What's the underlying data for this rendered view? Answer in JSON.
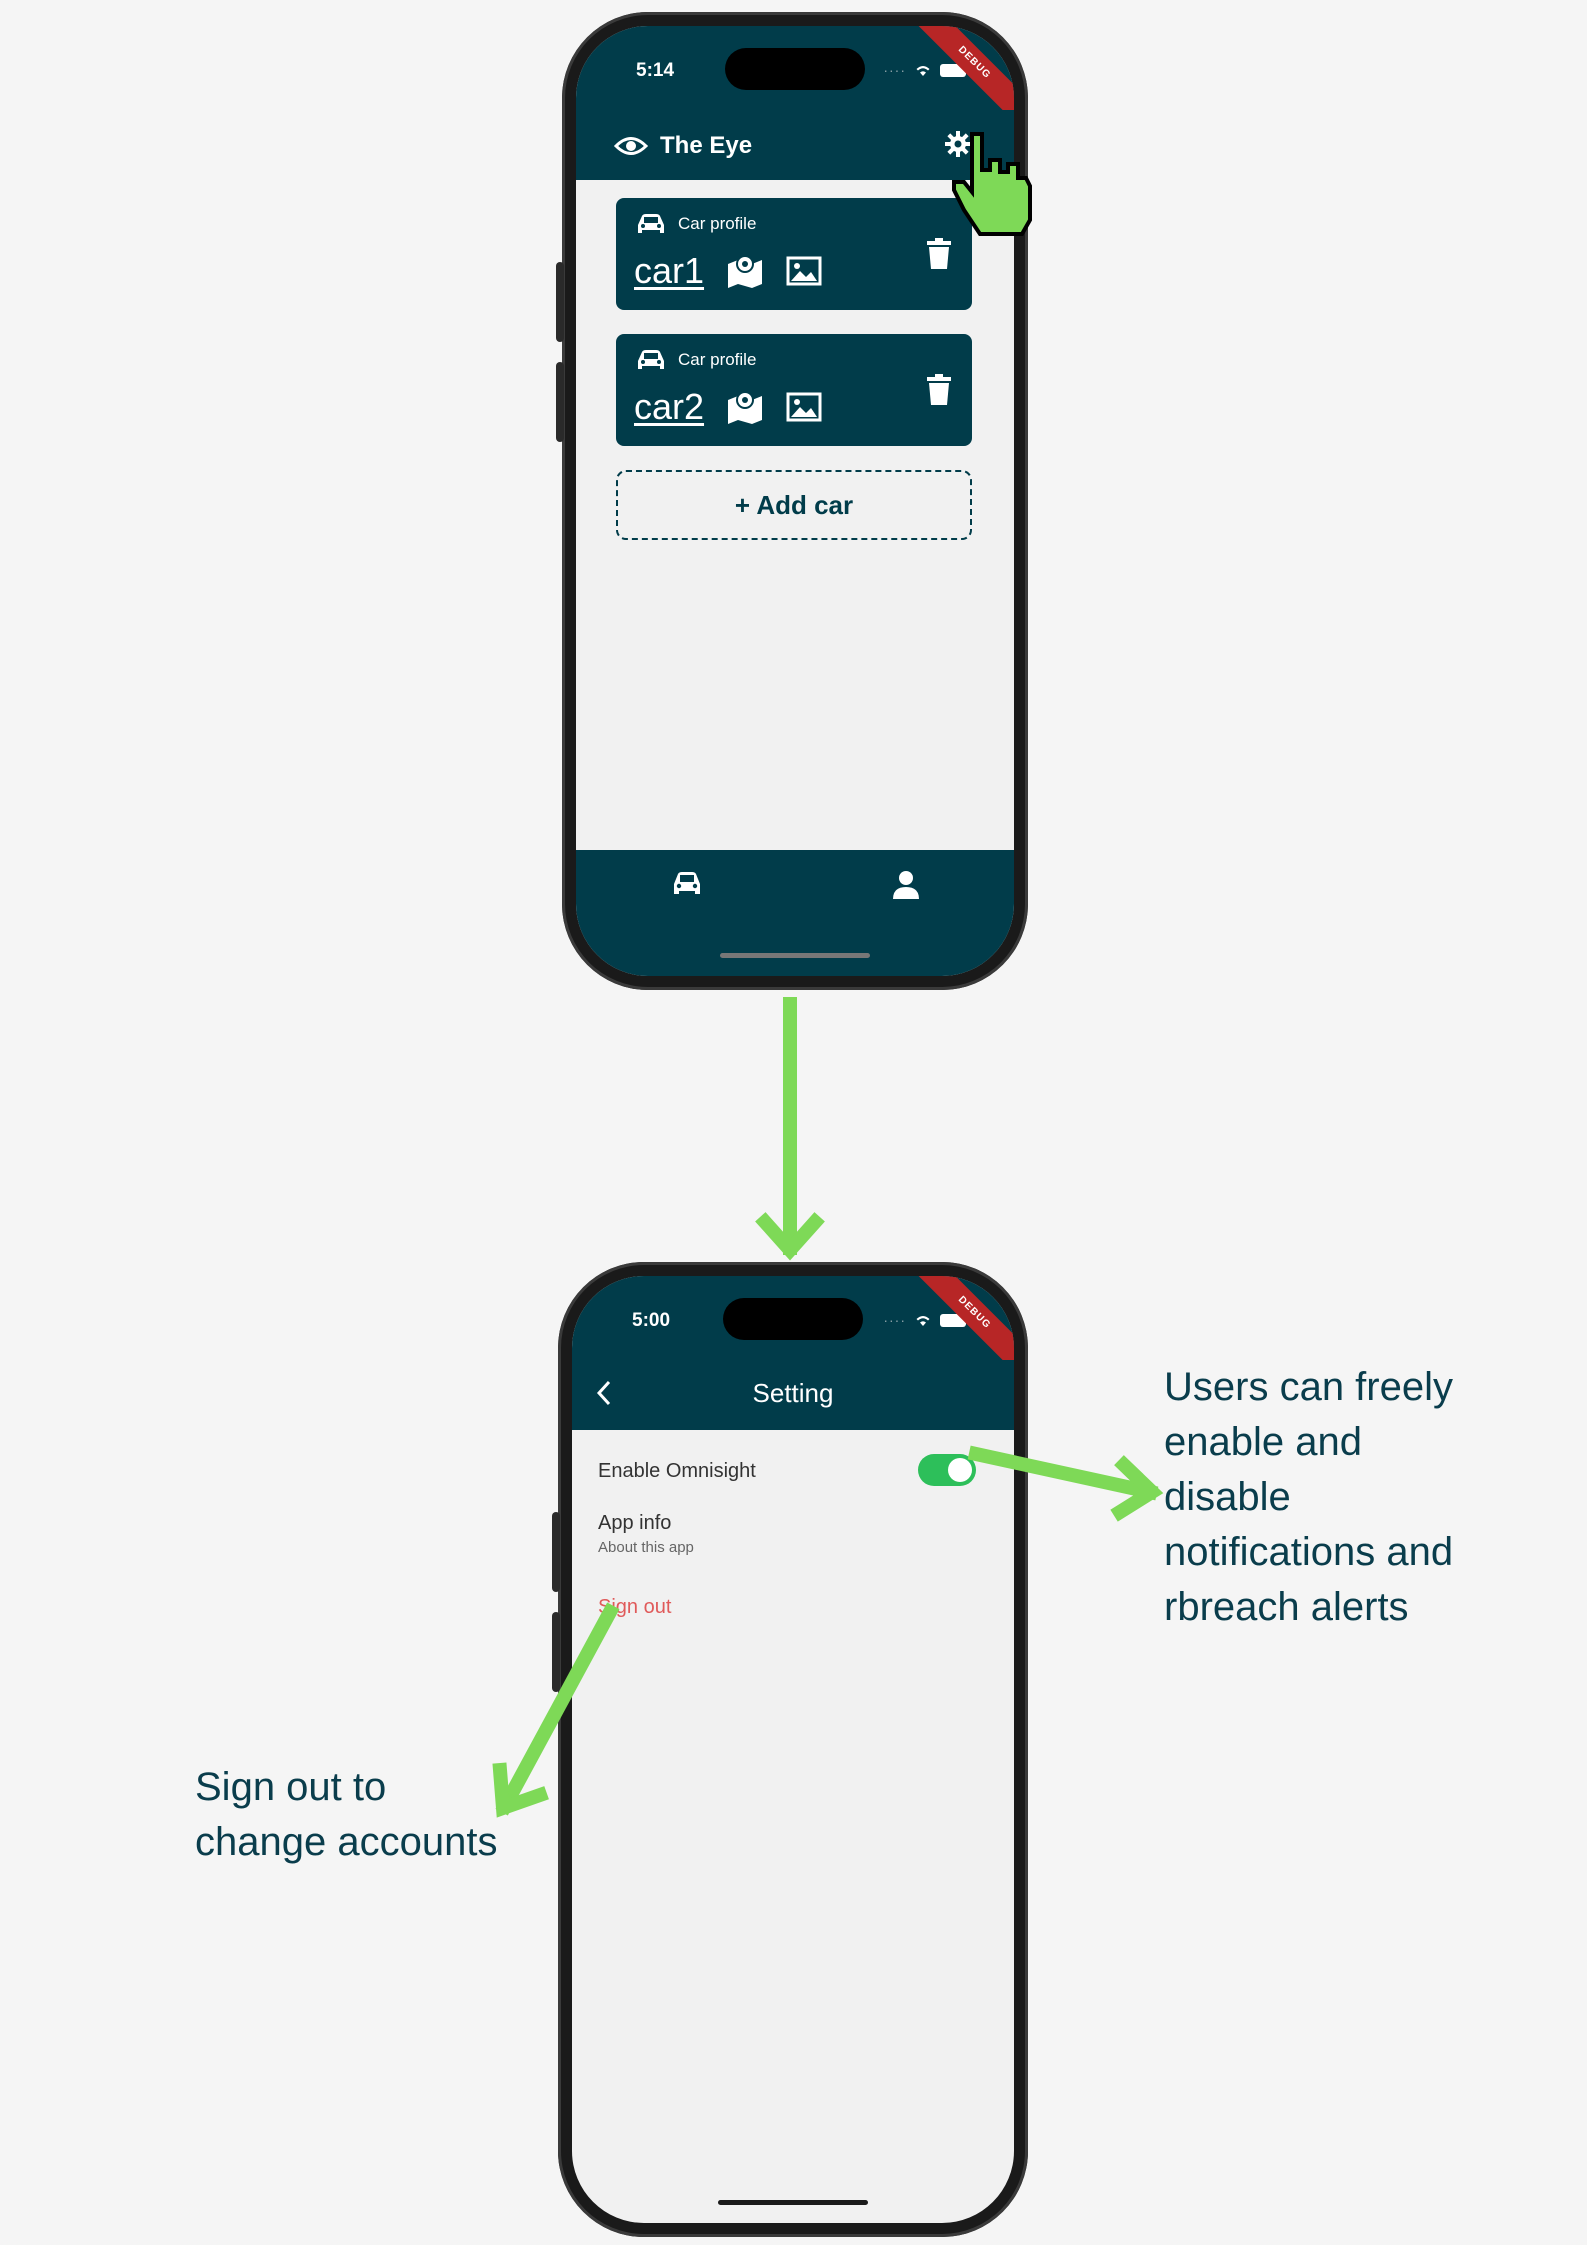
{
  "screen1": {
    "status_time": "5:14",
    "debug_label": "DEBUG",
    "app_title": "The Eye",
    "cars": [
      {
        "label": "Car profile",
        "name": "car1"
      },
      {
        "label": "Car profile",
        "name": "car2"
      }
    ],
    "add_car_label": "+ Add car"
  },
  "screen2": {
    "status_time": "5:00",
    "debug_label": "DEBUG",
    "title": "Setting",
    "enable_label": "Enable Omnisight",
    "enable_on": true,
    "app_info_label": "App info",
    "app_info_sub": "About this app",
    "sign_out_label": "Sign out"
  },
  "annotations": {
    "right": [
      "Users can freely",
      "enable and",
      "disable",
      "notifications and",
      "rbreach alerts"
    ],
    "left": [
      "Sign out to",
      "change accounts"
    ]
  },
  "colors": {
    "primary": "#013c4a",
    "accent_green": "#7ed957",
    "toggle_on": "#2dbf5a",
    "sign_out": "#e05a5a"
  },
  "icons": [
    "eye-icon",
    "gear-icon",
    "car-icon",
    "map-icon",
    "image-icon",
    "trash-icon",
    "plus-icon",
    "user-icon",
    "chevron-left-icon",
    "wifi-icon",
    "hand-cursor-icon"
  ]
}
